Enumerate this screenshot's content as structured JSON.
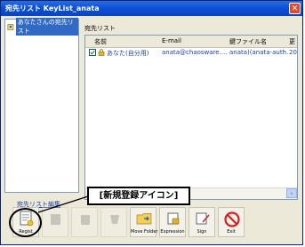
{
  "window": {
    "title": "宛先リスト KeyList_anata",
    "close_glyph": "✕"
  },
  "tree": {
    "item_label": "あなたさんの宛先リスト"
  },
  "panel": {
    "title": "宛先リスト",
    "columns": [
      "名前",
      "E-mail",
      "鍵ファイル名",
      "更"
    ],
    "rows": [
      {
        "name": "あなた(自分用)",
        "email": "anata@chaosware....",
        "keyfile": "anata)(anata-auth....",
        "updated": "200"
      }
    ]
  },
  "link_text": "宛先リスト編集",
  "toolbar": {
    "buttons": [
      {
        "label": "Regist",
        "enabled": true
      },
      {
        "label": "",
        "enabled": false
      },
      {
        "label": "",
        "enabled": false
      },
      {
        "label": "",
        "enabled": false
      },
      {
        "label": "Move Folder",
        "enabled": true
      },
      {
        "label": "Expression",
        "enabled": true
      },
      {
        "label": "Sign",
        "enabled": true
      },
      {
        "label": "Exit",
        "enabled": true
      }
    ]
  },
  "annotation": {
    "callout_text": "[新規登録アイコン]"
  },
  "colors": {
    "titlebar": "#0b4fd6",
    "selection": "#316ac5",
    "link": "#1c3ea8",
    "row_text": "#1a3fb5",
    "exit_red": "#d81e1e"
  }
}
